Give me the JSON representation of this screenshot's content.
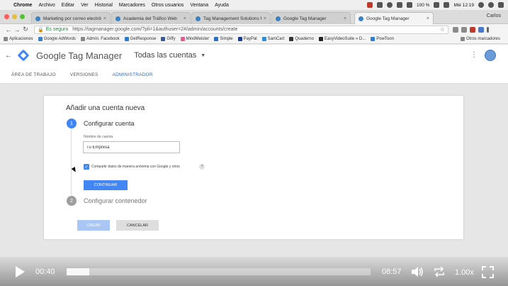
{
  "menubar": {
    "app": "Chrome",
    "items": [
      "Archivo",
      "Editar",
      "Ver",
      "Historial",
      "Marcadores",
      "Otros usuarios",
      "Ventana",
      "Ayuda"
    ],
    "battery": "100 %",
    "clock": "Mié 12:19"
  },
  "tabs": [
    {
      "title": "Marketing por correo electrónico"
    },
    {
      "title": "Academia del Tráfico Web"
    },
    {
      "title": "Tag Management Solutions fo"
    },
    {
      "title": "Google Tag Manager"
    },
    {
      "title": "Google Tag Manager"
    }
  ],
  "profile_name": "Carlos",
  "urlbar": {
    "secure_label": "Es seguro",
    "url": "https://tagmanager.google.com/?pli=1&authuser=2#/admin/accounts/create"
  },
  "bookmarks": [
    "Aplicaciones",
    "Google AdWords",
    "Admin. Facebook",
    "GetResponse",
    "Giffy",
    "MindMeister",
    "Simple",
    "PayPal",
    "SamCart",
    "Quaderno",
    "EasyVideoSuite » D...",
    "PowToon"
  ],
  "bookmarks_other": "Otros marcadores",
  "gtm": {
    "title": "Google Tag Manager",
    "accounts_label": "Todas las cuentas",
    "nav": [
      "ÁREA DE TRABAJO",
      "VERSIONES",
      "ADMINISTRADOR"
    ]
  },
  "form": {
    "title": "Añadir una cuenta nueva",
    "step1_number": "1",
    "step1_label": "Configurar cuenta",
    "field_label": "Nombre de cuenta",
    "field_value": "Tu Empresa",
    "checkbox_label": "Compartir datos de manera anónima con Google y otros",
    "help": "?",
    "continue_button": "CONTINUAR",
    "step2_number": "2",
    "step2_label": "Configurar contenedor",
    "create_button": "CREAR",
    "cancel_button": "CANCELAR"
  },
  "video": {
    "current_time": "00:40",
    "total_time": "08:57",
    "speed": "1.00x",
    "progress": 0.074
  }
}
